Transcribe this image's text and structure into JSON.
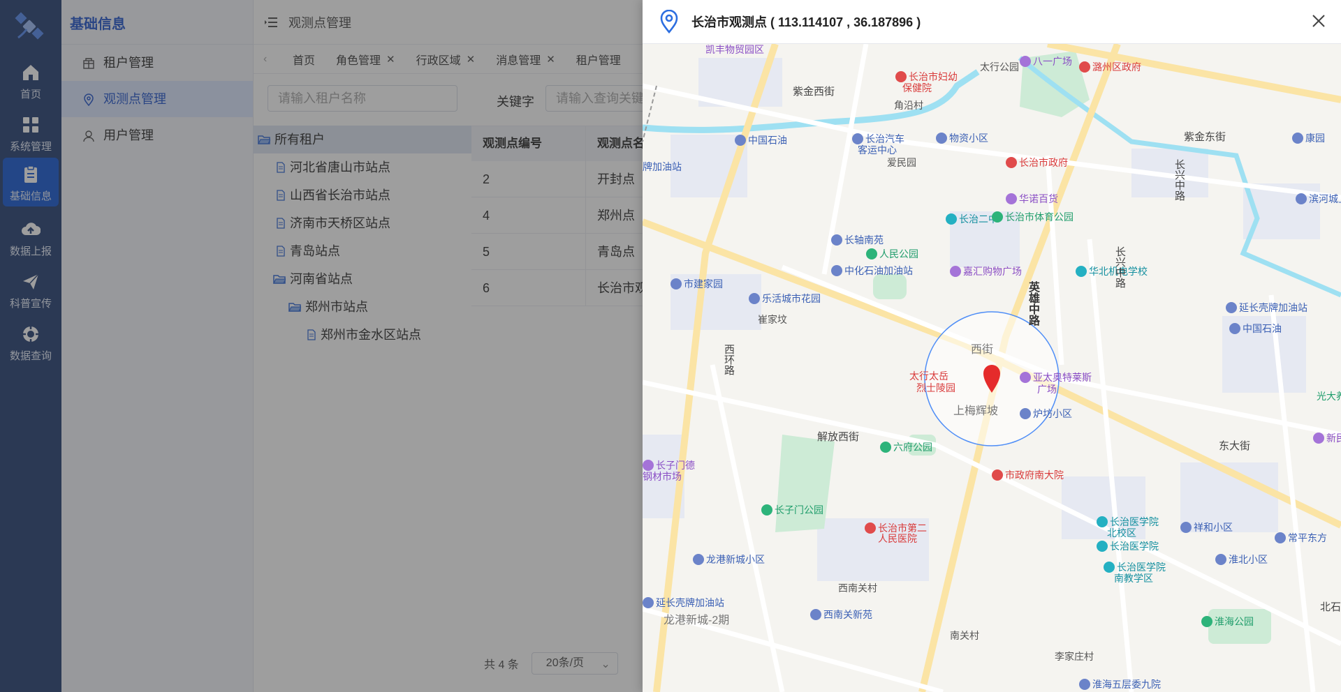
{
  "rail": {
    "items": [
      {
        "label": "首页",
        "icon": "home-icon"
      },
      {
        "label": "系统管理",
        "icon": "grid-icon"
      },
      {
        "label": "基础信息",
        "icon": "clipboard-icon"
      },
      {
        "label": "数据上报",
        "icon": "cloud-upload-icon"
      },
      {
        "label": "科普宣传",
        "icon": "paper-plane-icon"
      },
      {
        "label": "数据查询",
        "icon": "target-icon"
      }
    ]
  },
  "submenu": {
    "title": "基础信息",
    "items": [
      {
        "label": "租户管理",
        "icon": "building-icon"
      },
      {
        "label": "观测点管理",
        "icon": "location-icon"
      },
      {
        "label": "用户管理",
        "icon": "user-icon"
      }
    ]
  },
  "topbar": {
    "title": "观测点管理"
  },
  "tabs": [
    {
      "label": "首页"
    },
    {
      "label": "角色管理"
    },
    {
      "label": "行政区域"
    },
    {
      "label": "消息管理"
    },
    {
      "label": "租户管理"
    }
  ],
  "filter": {
    "tenant_placeholder": "请输入租户名称",
    "keyword_label": "关键字",
    "keyword_placeholder": "请输入查询关键字"
  },
  "tree": {
    "root": "所有租户",
    "nodes": [
      {
        "label": "河北省唐山市站点"
      },
      {
        "label": "山西省长治市站点"
      },
      {
        "label": "济南市天桥区站点"
      },
      {
        "label": "青岛站点"
      },
      {
        "label": "河南省站点"
      },
      {
        "label": "郑州市站点"
      },
      {
        "label": "郑州市金水区站点"
      }
    ]
  },
  "table": {
    "headers": [
      "观测点编号",
      "观测点名称"
    ],
    "rows": [
      [
        "2",
        "开封点"
      ],
      [
        "4",
        "郑州点"
      ],
      [
        "5",
        "青岛点"
      ],
      [
        "6",
        "长治市观测点"
      ]
    ]
  },
  "pager": {
    "total": "共 4 条",
    "page_size": "20条/页"
  },
  "drawer": {
    "title": "长治市观测点 ( 113.114107 , 36.187896 )"
  },
  "map": {
    "pois": [
      {
        "t": "凯丰物贸园区",
        "c": "purple",
        "nodot": true
      },
      {
        "t": "长治市妇幼",
        "c": "red"
      },
      {
        "t": "保健院",
        "c": "red",
        "nodot": true
      },
      {
        "t": "太行公园",
        "c": "gray",
        "nodot": true
      },
      {
        "t": "八一广场",
        "c": "purple"
      },
      {
        "t": "潞州区政府",
        "c": "red"
      },
      {
        "t": "紫金西街",
        "c": "road",
        "nodot": true
      },
      {
        "t": "角沿村",
        "c": "gray",
        "nodot": true
      },
      {
        "t": "长治汽车",
        "c": "blue"
      },
      {
        "t": "客运中心",
        "c": "blue",
        "nodot": true
      },
      {
        "t": "中国石油",
        "c": "blue"
      },
      {
        "t": "物资小区",
        "c": "blue"
      },
      {
        "t": "紫金东街",
        "c": "road",
        "nodot": true
      },
      {
        "t": "康园",
        "c": "blue"
      },
      {
        "t": "爱民园",
        "c": "gray",
        "nodot": true
      },
      {
        "t": "长治市政府",
        "c": "red"
      },
      {
        "t": "华诺百货",
        "c": "purple"
      },
      {
        "t": "滨河城上城",
        "c": "blue"
      },
      {
        "t": "牌加油站",
        "c": "blue",
        "nodot": true
      },
      {
        "t": "长治二中",
        "c": "teal"
      },
      {
        "t": "长治市体育公园",
        "c": "green"
      },
      {
        "t": "英雄中路",
        "c": "road-bold",
        "nodot": true
      },
      {
        "t": "长轴南苑",
        "c": "blue"
      },
      {
        "t": "人民公园",
        "c": "green"
      },
      {
        "t": "嘉汇购物广场",
        "c": "purple"
      },
      {
        "t": "华北机电学校",
        "c": "teal"
      },
      {
        "t": "延长壳牌加油站",
        "c": "blue"
      },
      {
        "t": "崔家坟",
        "c": "gray",
        "nodot": true
      },
      {
        "t": "中化石油加油站",
        "c": "blue"
      },
      {
        "t": "市建家园",
        "c": "blue"
      },
      {
        "t": "乐活城市花园",
        "c": "blue"
      },
      {
        "t": "西街",
        "c": "area",
        "nodot": true
      },
      {
        "t": "太行太岳",
        "c": "red",
        "nodot": true
      },
      {
        "t": "烈士陵园",
        "c": "red",
        "nodot": true
      },
      {
        "t": "亚太奥特莱斯",
        "c": "purple"
      },
      {
        "t": "广场",
        "c": "purple",
        "nodot": true
      },
      {
        "t": "中国石油",
        "c": "blue"
      },
      {
        "t": "光大养",
        "c": "green",
        "nodot": true
      },
      {
        "t": "上梅辉坡",
        "c": "area",
        "nodot": true
      },
      {
        "t": "炉坊小区",
        "c": "blue"
      },
      {
        "t": "解放西街",
        "c": "road",
        "nodot": true
      },
      {
        "t": "六府公园",
        "c": "green"
      },
      {
        "t": "东大街",
        "c": "road",
        "nodot": true
      },
      {
        "t": "新民装饰城",
        "c": "purple"
      },
      {
        "t": "长子门德",
        "c": "purple"
      },
      {
        "t": "钢材市场",
        "c": "purple",
        "nodot": true
      },
      {
        "t": "市政府南大院",
        "c": "red"
      },
      {
        "t": "长子门公园",
        "c": "green"
      },
      {
        "t": "长治市第二",
        "c": "red"
      },
      {
        "t": "人民医院",
        "c": "red",
        "nodot": true
      },
      {
        "t": "长治医学院",
        "c": "teal"
      },
      {
        "t": "北校区",
        "c": "teal",
        "nodot": true
      },
      {
        "t": "祥和小区",
        "c": "blue"
      },
      {
        "t": "常平东方",
        "c": "blue"
      },
      {
        "t": "长治医学院",
        "c": "teal"
      },
      {
        "t": "淮北小区",
        "c": "blue"
      },
      {
        "t": "龙港新城小区",
        "c": "blue"
      },
      {
        "t": "长治医学院",
        "c": "teal"
      },
      {
        "t": "南教学区",
        "c": "teal",
        "nodot": true
      },
      {
        "t": "西南关村",
        "c": "gray",
        "nodot": true
      },
      {
        "t": "延长壳牌加油站",
        "c": "blue"
      },
      {
        "t": "龙港新城-2期",
        "c": "area",
        "nodot": true
      },
      {
        "t": "西南关新苑",
        "c": "blue"
      },
      {
        "t": "淮海公园",
        "c": "green"
      },
      {
        "t": "北石",
        "c": "road",
        "nodot": true
      },
      {
        "t": "南关村",
        "c": "gray",
        "nodot": true
      },
      {
        "t": "李家庄村",
        "c": "gray",
        "nodot": true
      },
      {
        "t": "淮海五层委九院",
        "c": "blue"
      },
      {
        "t": "长兴中路",
        "c": "road",
        "nodot": true
      },
      {
        "t": "长兴中路",
        "c": "road",
        "nodot": true
      },
      {
        "t": "西环路",
        "c": "road",
        "nodot": true
      }
    ]
  },
  "colors": {
    "rail_bg": "#2f4778",
    "accent": "#1f5fd6",
    "marker": "#e52b2b"
  }
}
